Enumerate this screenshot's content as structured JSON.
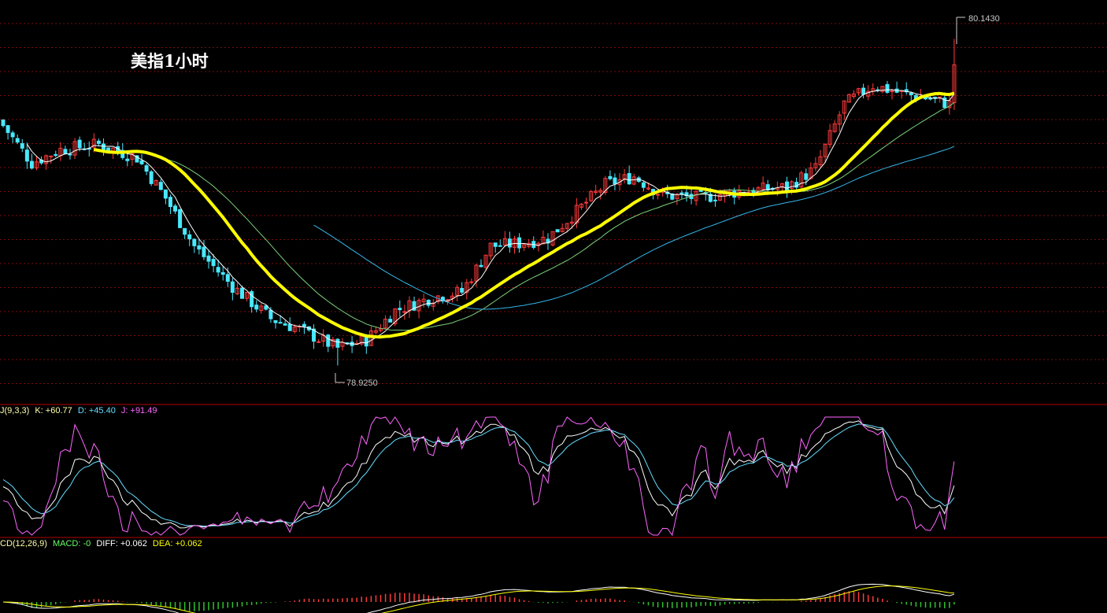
{
  "title": "美指1小时",
  "colors": {
    "up": "#ff3b3b",
    "down": "#49e8ff",
    "ma_main": "#ffff00",
    "ma_fast": "#ffffff",
    "ma_mid": "#7bd17b",
    "ma_slow": "#36b5e8",
    "grid": "#7a0d0d",
    "sep": "#b30000",
    "k": "#ffffff",
    "d": "#ffff66",
    "j": "#ff66ff",
    "macd_pos": "#ff3b3b",
    "macd_neg": "#2ec22e"
  },
  "chart_data": [
    {
      "type": "candlestick",
      "high_label": "80.1430",
      "low_label": "78.9250",
      "ylim": [
        78.85,
        80.2
      ]
    },
    {
      "type": "line",
      "name_label": "J(9,3,3)",
      "legend": [
        {
          "text": "K: +60.77",
          "color": "#ffffaa"
        },
        {
          "text": "D: +45.40",
          "color": "#66ddff"
        },
        {
          "text": "J: +91.49",
          "color": "#ff66ff"
        }
      ],
      "ylim": [
        0,
        100
      ]
    },
    {
      "type": "bar",
      "name_label": "CD(12,26,9)",
      "legend": [
        {
          "text": "MACD: -0",
          "color": "#66ff66"
        },
        {
          "text": "DIFF: +0.062",
          "color": "#ffffff"
        },
        {
          "text": "DEA: +0.062",
          "color": "#ffff00"
        }
      ]
    }
  ]
}
